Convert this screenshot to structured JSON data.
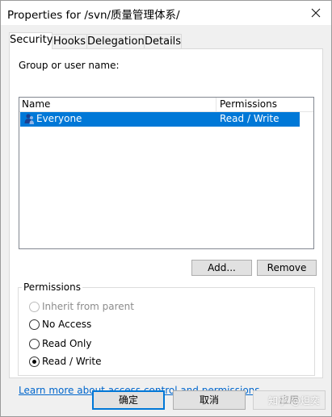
{
  "window": {
    "title": "Properties for /svn/质量管理体系/",
    "close_icon": "close-icon"
  },
  "tabs": [
    {
      "label": "Security",
      "active": true
    },
    {
      "label": "Hooks",
      "active": false
    },
    {
      "label": "Delegation",
      "active": false
    },
    {
      "label": "Details",
      "active": false
    }
  ],
  "security": {
    "group_label": "Group or user name:",
    "columns": {
      "name": "Name",
      "permissions": "Permissions"
    },
    "rows": [
      {
        "icon": "group-icon",
        "name": "Everyone",
        "permissions": "Read / Write",
        "selected": true
      }
    ],
    "add_button": "Add...",
    "remove_button": "Remove",
    "permissions_group_title": "Permissions",
    "options": [
      {
        "label": "Inherit from parent",
        "checked": false,
        "enabled": false
      },
      {
        "label": "No Access",
        "checked": false,
        "enabled": true
      },
      {
        "label": "Read Only",
        "checked": false,
        "enabled": true
      },
      {
        "label": "Read / Write",
        "checked": true,
        "enabled": true
      }
    ],
    "help_link": "Learn more about access control and permissions"
  },
  "footer": {
    "ok_button": "确定",
    "cancel_button": "取消",
    "apply_button": "应用",
    "watermark": "知乎 @炟奕"
  },
  "colors": {
    "selection": "#0078d7",
    "link": "#0066cc"
  }
}
